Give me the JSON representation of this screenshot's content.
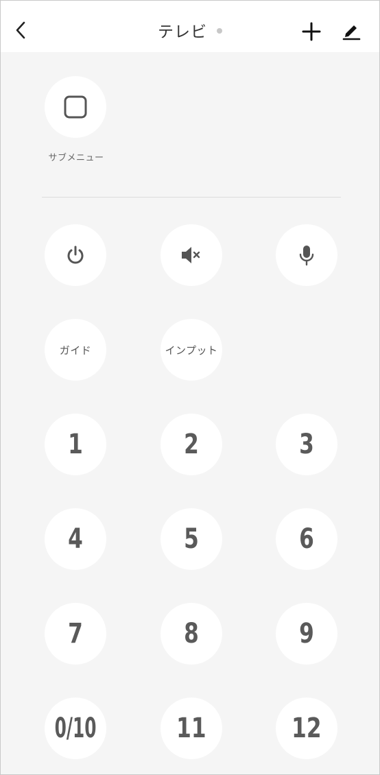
{
  "header": {
    "title": "テレビ",
    "back_icon": "chevron-left-icon",
    "add_icon": "plus-icon",
    "edit_icon": "pencil-icon"
  },
  "submenu": {
    "label": "サブメニュー",
    "icon": "square-icon"
  },
  "controls": {
    "power_icon": "power-icon",
    "mute_icon": "mute-icon",
    "mic_icon": "microphone-icon",
    "guide_label": "ガイド",
    "input_label": "インプット"
  },
  "numbers": [
    "1",
    "2",
    "3",
    "4",
    "5",
    "6",
    "7",
    "8",
    "9",
    "0/10",
    "11",
    "12"
  ],
  "colors": {
    "background": "#f5f5f5",
    "button": "#ffffff",
    "icon": "#555555",
    "status_dot": "#c8c8c8"
  }
}
